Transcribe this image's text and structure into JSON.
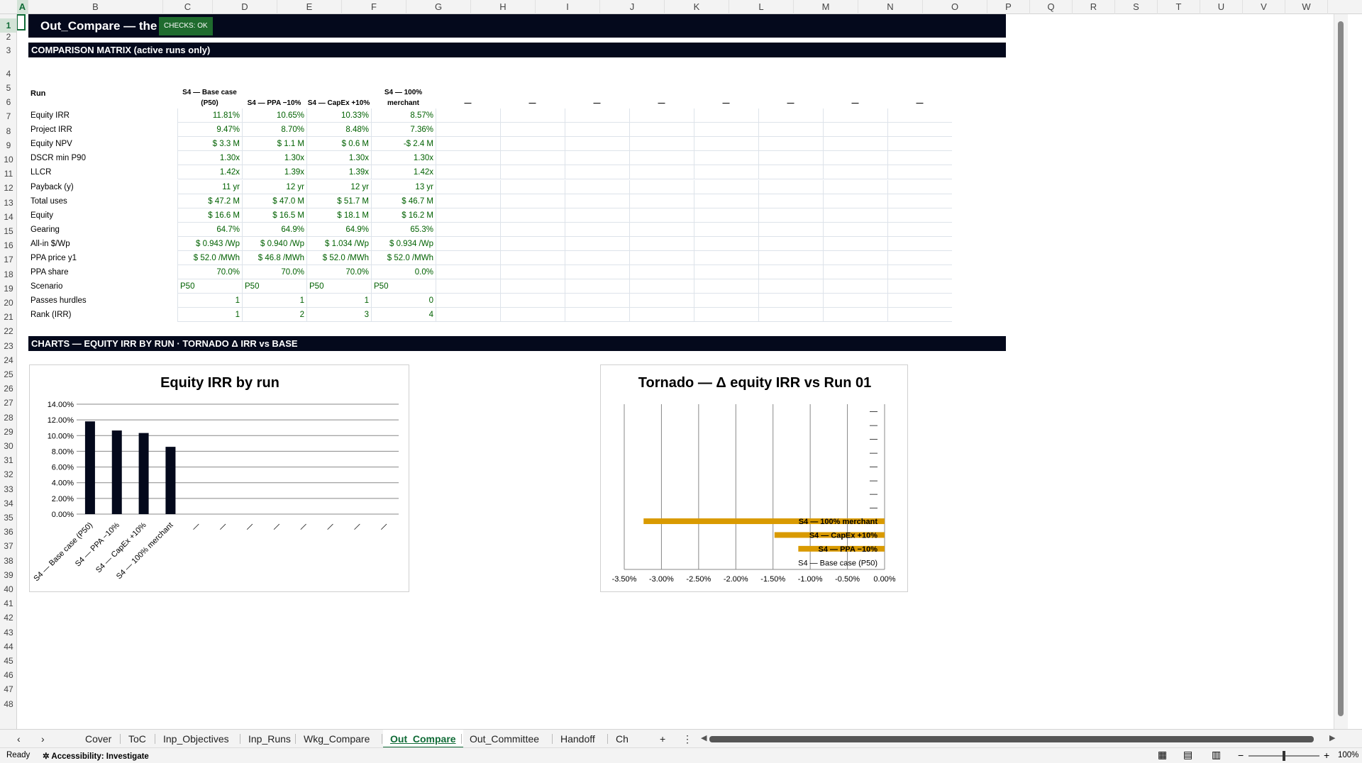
{
  "columns": [
    "A",
    "B",
    "C",
    "D",
    "E",
    "F",
    "G",
    "H",
    "I",
    "J",
    "K",
    "L",
    "M",
    "N",
    "O",
    "P",
    "Q",
    "R",
    "S",
    "T",
    "U",
    "V",
    "W"
  ],
  "rows": [
    "1",
    "2",
    "3",
    "4",
    "5",
    "6",
    "7",
    "8",
    "9",
    "10",
    "11",
    "12",
    "13",
    "14",
    "15",
    "16",
    "17",
    "18",
    "19",
    "20",
    "21",
    "22",
    "23",
    "24",
    "25",
    "26",
    "27",
    "28",
    "29",
    "30",
    "31",
    "32",
    "33",
    "34",
    "35",
    "36",
    "37",
    "38",
    "39",
    "40",
    "41",
    "42",
    "43",
    "44",
    "45",
    "46",
    "47",
    "48"
  ],
  "sheet": {
    "title": "Out_Compare — the",
    "checks_badge": "CHECKS: OK",
    "matrix_header": "COMPARISON MATRIX (active runs only)",
    "charts_header": "CHARTS — EQUITY IRR BY RUN · TORNADO Δ IRR vs BASE"
  },
  "matrix": {
    "run_label": "Run",
    "run_headers": [
      "S4 — Base case (P50)",
      "S4 — PPA −10%",
      "S4 — CapEx +10%",
      "S4 — 100% merchant",
      "—",
      "—",
      "—",
      "—",
      "—",
      "—",
      "—",
      "—"
    ],
    "rows": [
      {
        "label": "Equity IRR",
        "values": [
          "11.81%",
          "10.65%",
          "10.33%",
          "8.57%"
        ]
      },
      {
        "label": "Project IRR",
        "values": [
          "9.47%",
          "8.70%",
          "8.48%",
          "7.36%"
        ]
      },
      {
        "label": "Equity NPV",
        "values": [
          "$ 3.3 M",
          "$ 1.1 M",
          "$ 0.6 M",
          "-$ 2.4 M"
        ]
      },
      {
        "label": "DSCR min P90",
        "values": [
          "1.30x",
          "1.30x",
          "1.30x",
          "1.30x"
        ]
      },
      {
        "label": "LLCR",
        "values": [
          "1.42x",
          "1.39x",
          "1.39x",
          "1.42x"
        ]
      },
      {
        "label": "Payback (y)",
        "values": [
          "11 yr",
          "12 yr",
          "12 yr",
          "13 yr"
        ]
      },
      {
        "label": "Total uses",
        "values": [
          "$ 47.2 M",
          "$ 47.0 M",
          "$ 51.7 M",
          "$ 46.7 M"
        ]
      },
      {
        "label": "Equity",
        "values": [
          "$ 16.6 M",
          "$ 16.5 M",
          "$ 18.1 M",
          "$ 16.2 M"
        ]
      },
      {
        "label": "Gearing",
        "values": [
          "64.7%",
          "64.9%",
          "64.9%",
          "65.3%"
        ]
      },
      {
        "label": "All-in $/Wp",
        "values": [
          "$ 0.943 /Wp",
          "$ 0.940 /Wp",
          "$ 1.034 /Wp",
          "$ 0.934 /Wp"
        ]
      },
      {
        "label": "PPA price y1",
        "values": [
          "$ 52.0 /MWh",
          "$ 46.8 /MWh",
          "$ 52.0 /MWh",
          "$ 52.0 /MWh"
        ]
      },
      {
        "label": "PPA share",
        "values": [
          "70.0%",
          "70.0%",
          "70.0%",
          "0.0%"
        ]
      },
      {
        "label": "Scenario",
        "values": [
          "P50",
          "P50",
          "P50",
          "P50"
        ],
        "align": "left"
      },
      {
        "label": "Passes hurdles",
        "values": [
          "1",
          "1",
          "1",
          "0"
        ]
      },
      {
        "label": "Rank (IRR)",
        "values": [
          "1",
          "2",
          "3",
          "4"
        ]
      }
    ]
  },
  "chart_data": [
    {
      "type": "bar",
      "title": "Equity IRR by run",
      "categories": [
        "S4 — Base case (P50)",
        "S4 — PPA −10%",
        "S4 — CapEx +10%",
        "S4 — 100% merchant",
        "—",
        "—",
        "—",
        "—",
        "—",
        "—",
        "—",
        "—"
      ],
      "values": [
        11.81,
        10.65,
        10.33,
        8.57,
        null,
        null,
        null,
        null,
        null,
        null,
        null,
        null
      ],
      "ylim": [
        0,
        14
      ],
      "yticks": [
        "0.00%",
        "2.00%",
        "4.00%",
        "6.00%",
        "8.00%",
        "10.00%",
        "12.00%",
        "14.00%"
      ],
      "grid": true,
      "color": "#04091c"
    },
    {
      "type": "bar",
      "orientation": "horizontal",
      "title": "Tornado — Δ equity IRR vs Run 01",
      "categories": [
        "S4 — Base case (P50)",
        "S4 — PPA −10%",
        "S4 — CapEx +10%",
        "S4 — 100% merchant",
        "—",
        "—",
        "—",
        "—",
        "—",
        "—",
        "—",
        "—"
      ],
      "values": [
        0,
        -1.16,
        -1.48,
        -3.24,
        null,
        null,
        null,
        null,
        null,
        null,
        null,
        null
      ],
      "xlim": [
        -3.5,
        0
      ],
      "xticks": [
        "-3.50%",
        "-3.00%",
        "-2.50%",
        "-2.00%",
        "-1.50%",
        "-1.00%",
        "-0.50%",
        "0.00%"
      ],
      "grid": true,
      "color": "#d99a00"
    }
  ],
  "tabs": [
    "Cover",
    "ToC",
    "Inp_Objectives",
    "Inp_Runs",
    "Wkg_Compare",
    "Out_Compare",
    "Out_Committee",
    "Handoff",
    "Ch"
  ],
  "active_tab": "Out_Compare",
  "status": {
    "ready": "Ready",
    "accessibility": "Accessibility: Investigate",
    "zoom": "100%"
  }
}
